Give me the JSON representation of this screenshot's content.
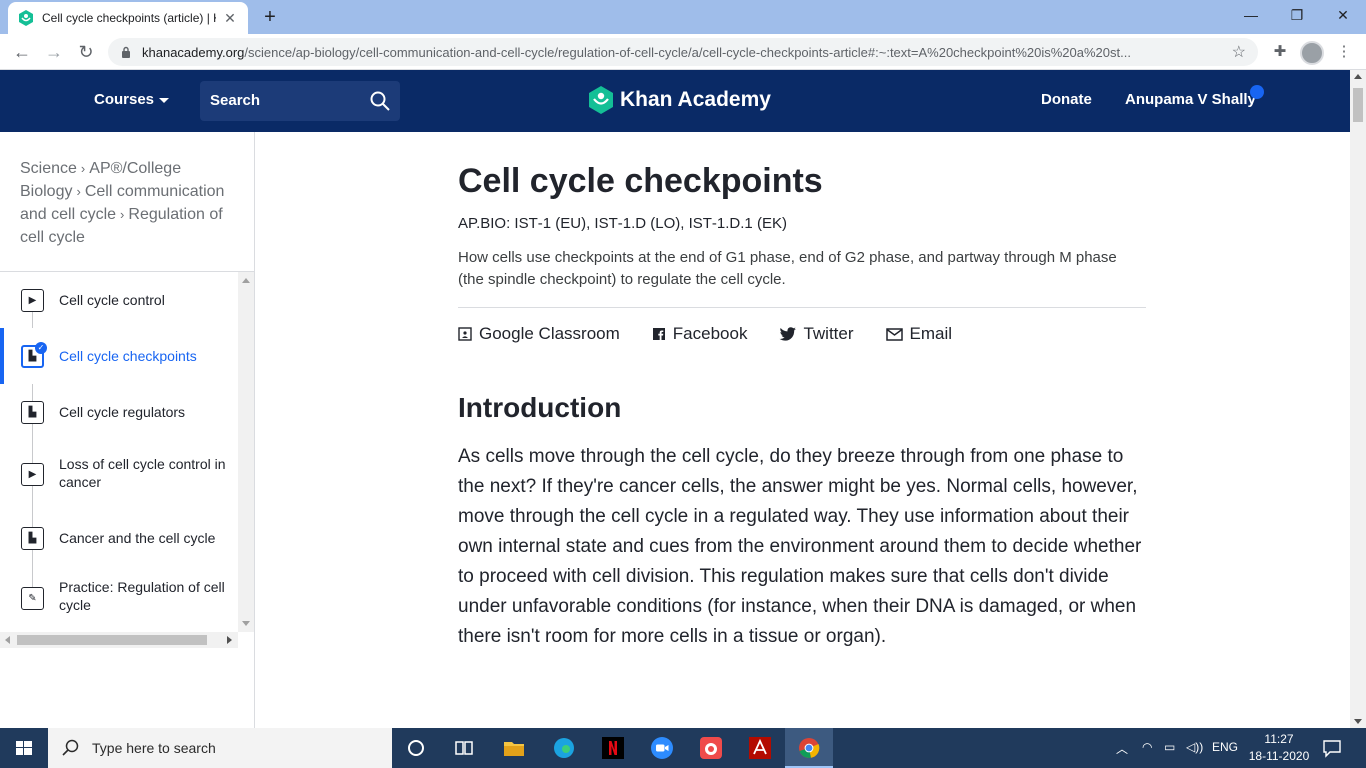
{
  "browser": {
    "tab_title": "Cell cycle checkpoints (article) | K",
    "new_tab": "+",
    "close_tab": "✕",
    "window_controls": [
      "—",
      "❐",
      "✕"
    ],
    "url_host": "khanacademy.org",
    "url_path": "/science/ap-biology/cell-communication-and-cell-cycle/regulation-of-cell-cycle/a/cell-cycle-checkpoints-article#:~:text=A%20checkpoint%20is%20a%20st..."
  },
  "header": {
    "courses_label": "Courses",
    "search_label": "Search",
    "logo_text": "Khan Academy",
    "donate_label": "Donate",
    "user_name": "Anupama V Shally",
    "brand_color": "#0a2a66",
    "accent_color": "#1865f2"
  },
  "sidebar": {
    "breadcrumbs": [
      "Science",
      "AP®︎/College Biology",
      "Cell communication and cell cycle",
      "Regulation of cell cycle"
    ],
    "lessons": [
      {
        "label": "Cell cycle control",
        "icon": "play-icon",
        "active": false
      },
      {
        "label": "Cell cycle checkpoints",
        "icon": "article-icon",
        "active": true
      },
      {
        "label": "Cell cycle regulators",
        "icon": "article-icon",
        "active": false
      },
      {
        "label": "Loss of cell cycle control in cancer",
        "icon": "play-icon",
        "active": false
      },
      {
        "label": "Cancer and the cell cycle",
        "icon": "article-icon",
        "active": false
      },
      {
        "label": "Practice: Regulation of cell cycle",
        "icon": "pencil-icon",
        "active": false
      }
    ]
  },
  "article": {
    "title": "Cell cycle checkpoints",
    "standards": "AP.BIO: IST‑1 (EU), IST‑1.D (LO), IST‑1.D.1 (EK)",
    "description": "How cells use checkpoints at the end of G1 phase, end of G2 phase, and partway through M phase (the spindle checkpoint) to regulate the cell cycle.",
    "share": {
      "google_classroom": "Google Classroom",
      "facebook": "Facebook",
      "twitter": "Twitter",
      "email": "Email"
    },
    "intro_heading": "Introduction",
    "intro_body": "As cells move through the cell cycle, do they breeze through from one phase to the next? If they're cancer cells, the answer might be yes. Normal cells, however, move through the cell cycle in a regulated way. They use information about their own internal state and cues from the environment around them to decide whether to proceed with cell division. This regulation makes sure that cells don't divide under unfavorable conditions (for instance, when their DNA is damaged, or when there isn't room for more cells in a tissue or organ)."
  },
  "taskbar": {
    "search_placeholder": "Type here to search",
    "language": "ENG",
    "time": "11:27",
    "date": "18-11-2020"
  }
}
